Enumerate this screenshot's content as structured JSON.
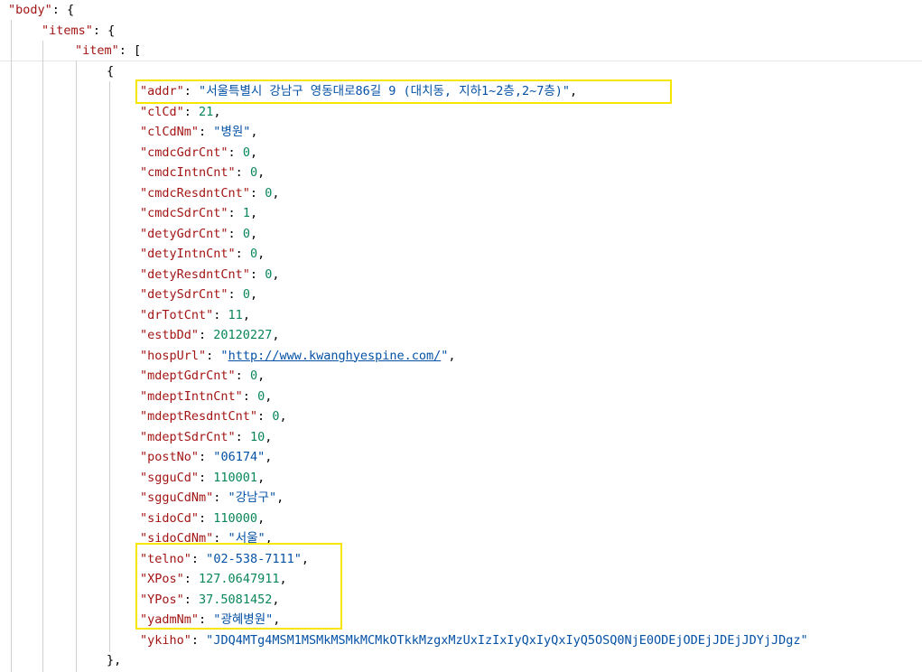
{
  "json": {
    "root_key": "body",
    "items_key": "items",
    "item_key": "item",
    "fields": [
      {
        "key": "addr",
        "value": "서울특별시 강남구 영동대로86길 9 (대치동, 지하1~2층,2~7층)",
        "type": "string",
        "highlight": true
      },
      {
        "key": "clCd",
        "value": "21",
        "type": "number"
      },
      {
        "key": "clCdNm",
        "value": "병원",
        "type": "string"
      },
      {
        "key": "cmdcGdrCnt",
        "value": "0",
        "type": "number"
      },
      {
        "key": "cmdcIntnCnt",
        "value": "0",
        "type": "number"
      },
      {
        "key": "cmdcResdntCnt",
        "value": "0",
        "type": "number"
      },
      {
        "key": "cmdcSdrCnt",
        "value": "1",
        "type": "number"
      },
      {
        "key": "detyGdrCnt",
        "value": "0",
        "type": "number"
      },
      {
        "key": "detyIntnCnt",
        "value": "0",
        "type": "number"
      },
      {
        "key": "detyResdntCnt",
        "value": "0",
        "type": "number"
      },
      {
        "key": "detySdrCnt",
        "value": "0",
        "type": "number"
      },
      {
        "key": "drTotCnt",
        "value": "11",
        "type": "number"
      },
      {
        "key": "estbDd",
        "value": "20120227",
        "type": "number"
      },
      {
        "key": "hospUrl",
        "value": "http://www.kwanghyespine.com/",
        "type": "url"
      },
      {
        "key": "mdeptGdrCnt",
        "value": "0",
        "type": "number"
      },
      {
        "key": "mdeptIntnCnt",
        "value": "0",
        "type": "number"
      },
      {
        "key": "mdeptResdntCnt",
        "value": "0",
        "type": "number"
      },
      {
        "key": "mdeptSdrCnt",
        "value": "10",
        "type": "number"
      },
      {
        "key": "postNo",
        "value": "06174",
        "type": "string"
      },
      {
        "key": "sgguCd",
        "value": "110001",
        "type": "number"
      },
      {
        "key": "sgguCdNm",
        "value": "강남구",
        "type": "string"
      },
      {
        "key": "sidoCd",
        "value": "110000",
        "type": "number"
      },
      {
        "key": "sidoCdNm",
        "value": "서울",
        "type": "string"
      },
      {
        "key": "telno",
        "value": "02-538-7111",
        "type": "string",
        "highlight": true
      },
      {
        "key": "XPos",
        "value": "127.0647911",
        "type": "number",
        "highlight": true
      },
      {
        "key": "YPos",
        "value": "37.5081452",
        "type": "number",
        "highlight": true
      },
      {
        "key": "yadmNm",
        "value": "광혜병원",
        "type": "string",
        "highlight": true
      },
      {
        "key": "ykiho",
        "value": "JDQ4MTg4MSM1MSMkMSMkMCMkOTkkMzgxMzUxIzIxIyQxIyQxIyQ5OSQ0NjE0ODEjODEjJDEjJDYjJDgz",
        "type": "string"
      }
    ]
  },
  "colors": {
    "key": "#a31515",
    "string": "#0451a5",
    "number": "#098658",
    "highlight_border": "#f7e600"
  }
}
